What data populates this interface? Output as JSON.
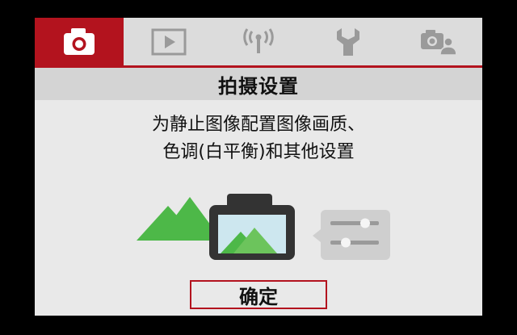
{
  "tabs": [
    {
      "id": "shooting",
      "icon": "camera-icon",
      "active": true
    },
    {
      "id": "playback",
      "icon": "play-icon",
      "active": false
    },
    {
      "id": "wireless",
      "icon": "wireless-icon",
      "active": false
    },
    {
      "id": "setup",
      "icon": "wrench-icon",
      "active": false
    },
    {
      "id": "custom",
      "icon": "camera-person-icon",
      "active": false
    }
  ],
  "header": {
    "title": "拍摄设置"
  },
  "description": {
    "line1": "为静止图像配置图像画质、",
    "line2": "色调(白平衡)和其他设置"
  },
  "illustration": {
    "items": [
      "mountains-icon",
      "camera-screen-icon",
      "sliders-icon"
    ]
  },
  "confirm": {
    "label": "确定"
  },
  "colors": {
    "accent": "#b3131e",
    "green": "#4db848",
    "panel": "#e9e9e9",
    "icon_gray": "#9a9a9a"
  }
}
